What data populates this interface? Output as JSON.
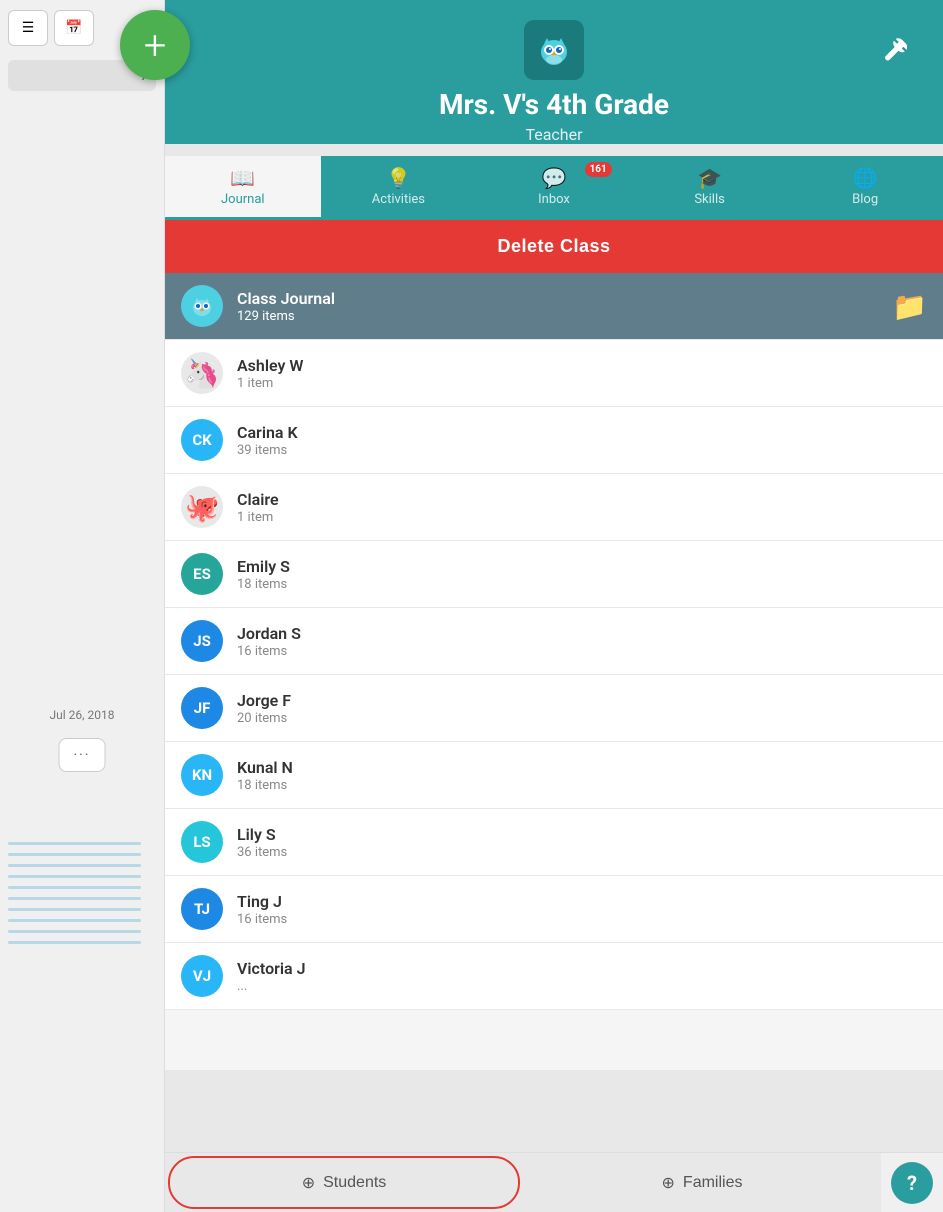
{
  "sidebar": {
    "date": "Jul 26, 2018",
    "more_label": "···",
    "expand_icon": "›"
  },
  "header": {
    "title": "Mrs. V's 4th Grade",
    "subtitle": "Teacher",
    "owl_emoji": "🦉"
  },
  "tabs": [
    {
      "id": "journal",
      "label": "Journal",
      "icon": "📖",
      "active": true,
      "badge": null
    },
    {
      "id": "activities",
      "label": "Activities",
      "icon": "💡",
      "active": false,
      "badge": null
    },
    {
      "id": "inbox",
      "label": "Inbox",
      "icon": "💬",
      "active": false,
      "badge": "161"
    },
    {
      "id": "skills",
      "label": "Skills",
      "icon": "🎓",
      "active": false,
      "badge": null
    },
    {
      "id": "blog",
      "label": "Blog",
      "icon": "🌐",
      "active": false,
      "badge": null
    }
  ],
  "delete_button_label": "Delete Class",
  "class_journal": {
    "name": "Class Journal",
    "count": "129 items"
  },
  "students": [
    {
      "id": "ashley",
      "name": "Ashley W",
      "count": "1 item",
      "initials": "",
      "emoji": "🦄",
      "color": "#e0e0e0",
      "is_emoji": true
    },
    {
      "id": "carina",
      "name": "Carina K",
      "count": "39 items",
      "initials": "CK",
      "color": "#29b6f6",
      "is_emoji": false
    },
    {
      "id": "claire",
      "name": "Claire",
      "count": "1 item",
      "initials": "",
      "emoji": "🐙",
      "color": "#e0e0e0",
      "is_emoji": true
    },
    {
      "id": "emily",
      "name": "Emily S",
      "count": "18 items",
      "initials": "ES",
      "color": "#26a69a",
      "is_emoji": false
    },
    {
      "id": "jordan",
      "name": "Jordan S",
      "count": "16 items",
      "initials": "JS",
      "color": "#1e88e5",
      "is_emoji": false
    },
    {
      "id": "jorge",
      "name": "Jorge F",
      "count": "20 items",
      "initials": "JF",
      "color": "#1e88e5",
      "is_emoji": false
    },
    {
      "id": "kunal",
      "name": "Kunal N",
      "count": "18 items",
      "initials": "KN",
      "color": "#29b6f6",
      "is_emoji": false
    },
    {
      "id": "lily",
      "name": "Lily S",
      "count": "36 items",
      "initials": "LS",
      "color": "#26c6da",
      "is_emoji": false
    },
    {
      "id": "ting",
      "name": "Ting J",
      "count": "16 items",
      "initials": "TJ",
      "color": "#1e88e5",
      "is_emoji": false
    },
    {
      "id": "victoria",
      "name": "Victoria J",
      "count": "...",
      "initials": "VJ",
      "color": "#29b6f6",
      "is_emoji": false
    }
  ],
  "bottom": {
    "students_label": "Students",
    "families_label": "Families",
    "students_icon": "+",
    "families_icon": "+",
    "help_label": "?"
  },
  "plus_button": {
    "icon": "+"
  },
  "settings_icon": "⚙"
}
